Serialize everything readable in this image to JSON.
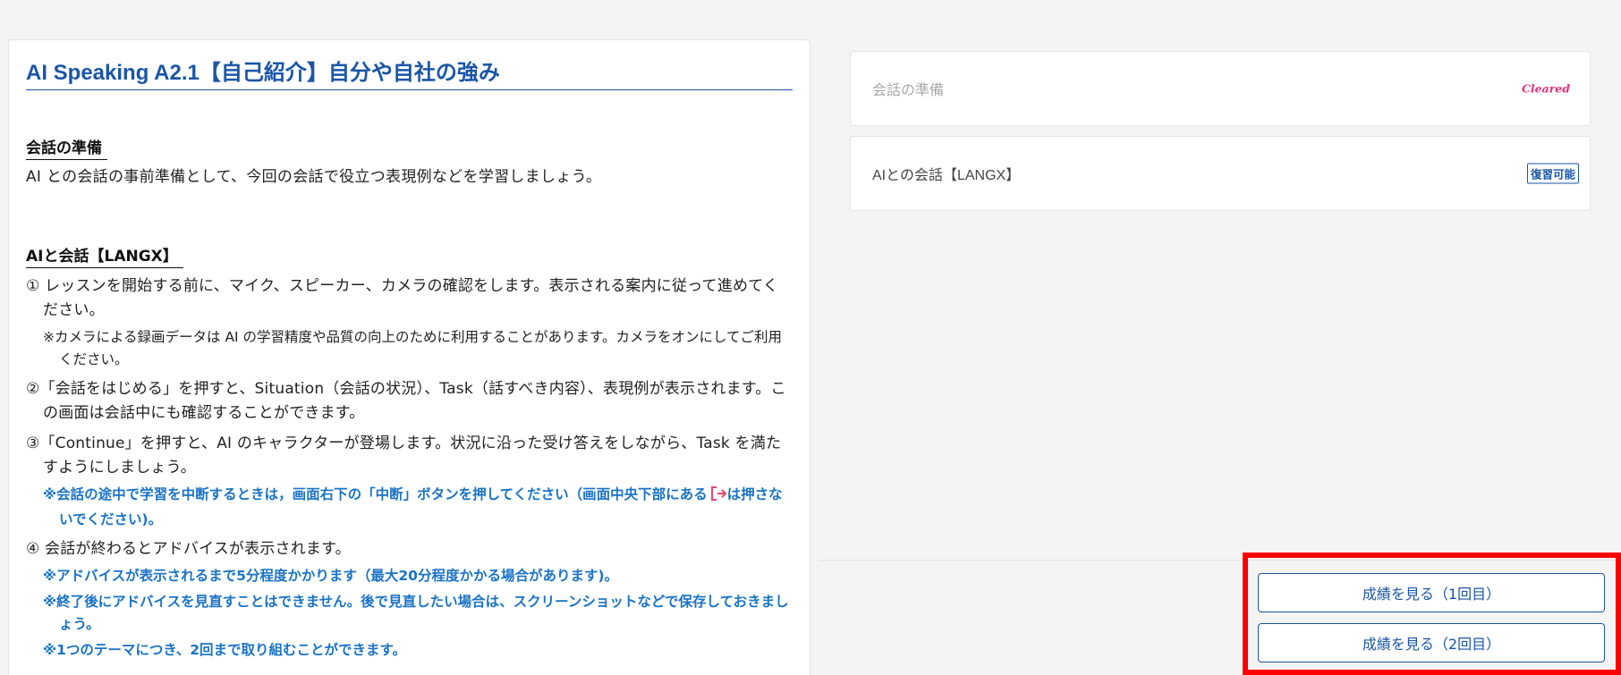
{
  "lesson": {
    "title": "AI Speaking A2.1【自己紹介】自分や自社の強み",
    "prep_heading": "会話の準備",
    "prep_text": "AI との会話の事前準備として、今回の会話で役立つ表現例などを学習しましょう。",
    "ai_heading": "AIと会話【LANGX】",
    "step1": "① レッスンを開始する前に、マイク、スピーカー、カメラの確認をします。表示される案内に従って進めてください。",
    "step1_note": "※カメラによる録画データは AI の学習精度や品質の向上のために利用することがあります。カメラをオンにしてご利用ください。",
    "step2": "②「会話をはじめる」を押すと、Situation（会話の状況）、Task（話すべき内容）、表現例が表示されます。この画面は会話中にも確認することができます。",
    "step3": "③「Continue」を押すと、AI のキャラクターが登場します。状況に沿った受け答えをしながら、Task を満たすようにしましょう。",
    "step3_note_a": "※会話の途中で学習を中断するときは，画面右下の「中断」ボタンを押してください（画面中央下部にある",
    "step3_note_b": "は押さないでください)。",
    "step4": "④ 会話が終わるとアドバイスが表示されます。",
    "step4_note1": "※アドバイスが表示されるまで5分程度かかります（最大20分程度かかる場合があります)。",
    "step4_note2": "※終了後にアドバイスを見直すことはできません。後で見直したい場合は、スクリーンショットなどで保存しておきましょう。",
    "step4_note3": "※1つのテーマにつき、2回まで取り組むことができます。"
  },
  "cards": [
    {
      "label": "会話の準備",
      "badge": "Cleared"
    },
    {
      "label": "AIとの会話【LANGX】",
      "badge": "復習可能"
    }
  ],
  "buttons": {
    "score1": "成績を見る（1回目）",
    "score2": "成績を見る（2回目）"
  },
  "icons": {
    "exit": "exit-icon"
  },
  "colors": {
    "title_blue": "#1a56a7",
    "note_blue": "#1a73c6",
    "cleared_pink": "#e4317f",
    "exit_icon": "#e8436e",
    "highlight_red": "#ff0000"
  }
}
